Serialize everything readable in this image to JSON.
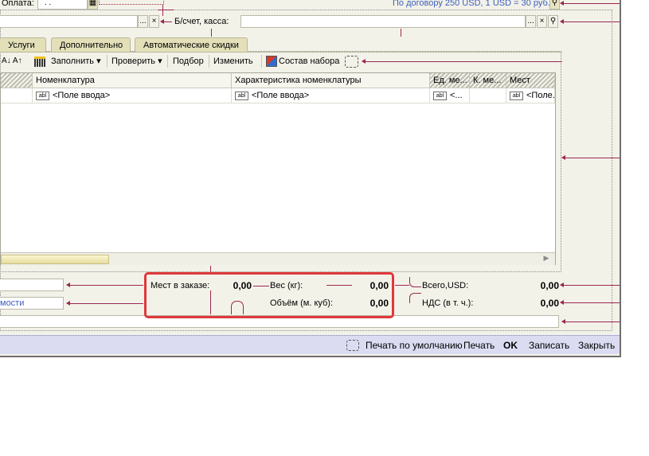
{
  "header": {
    "payment_label": "Оплата:",
    "payment_value": ". .",
    "contract_note": "По договору 250 USD, 1 USD = 30 руб.",
    "cash_label": "Б/счет, касса:",
    "select_btn": "...",
    "clear_btn": "×"
  },
  "tabs": [
    {
      "label": "Услуги"
    },
    {
      "label": "Дополнительно"
    },
    {
      "label": "Автоматические скидки"
    }
  ],
  "toolbar": {
    "fill_label": "Заполнить",
    "check_label": "Проверить",
    "select_label": "Подбор",
    "edit_label": "Изменить",
    "set_label": "Состав набора"
  },
  "grid": {
    "columns": [
      "Номенклатура",
      "Характеристика номенклатуры",
      "Ед. ме...",
      "К. ме...",
      "Мест"
    ],
    "row": [
      "<Поле ввода>",
      "<Поле ввода>",
      "<...",
      "",
      "<Поле..."
    ]
  },
  "totals": {
    "places_label": "Мест в заказе:",
    "places_value": "0,00",
    "weight_label": "Вес (кг):",
    "weight_value": "0,00",
    "volume_label": "Объём (м. куб):",
    "volume_value": "0,00",
    "total_label": "Всего,USD:",
    "total_value": "0,00",
    "vat_label": "НДС (в т. ч.):",
    "vat_value": "0,00",
    "left_field_text": "мости"
  },
  "statusbar": {
    "print_default": "Печать по умолчанию",
    "print": "Печать",
    "ok": "OK",
    "save": "Записать",
    "close": "Закрыть"
  },
  "colors": {
    "accent_line": "#9b2751",
    "highlight": "#e0383b",
    "statusbar": "#dbdcf2",
    "link": "#3c5fbe"
  }
}
